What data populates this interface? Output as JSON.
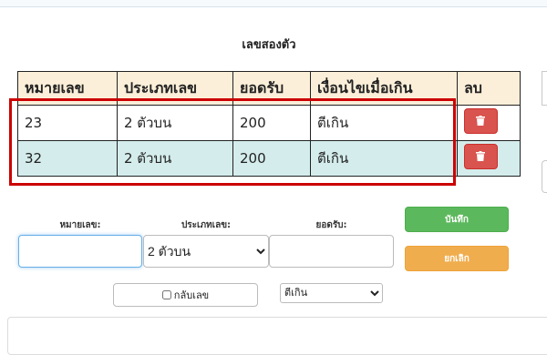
{
  "section_title": "เลขสองตัว",
  "table": {
    "headers": [
      "หมายเลข",
      "ประเภทเลข",
      "ยอดรับ",
      "เงื่อนไขเมื่อเกิน",
      "ลบ"
    ],
    "rows": [
      {
        "number": "23",
        "type": "2 ตัวบน",
        "amount": "200",
        "condition": "ตีเกิน"
      },
      {
        "number": "32",
        "type": "2 ตัวบน",
        "amount": "200",
        "condition": "ตีเกิน"
      }
    ],
    "delete_icon": "trash-icon"
  },
  "form": {
    "number_label": "หมายเลข:",
    "number_value": "",
    "type_label": "ประเภทเลข:",
    "type_selected": "2 ตัวบน",
    "amount_label": "ยอดรับ:",
    "amount_value": "",
    "save_label": "บันทึก",
    "cancel_label": "ยกเลิก",
    "reverse_label": "กลับเลข",
    "reverse_checked": false,
    "condition_selected": "ตีเกิน"
  },
  "colors": {
    "header_bg": "#fcefd9",
    "alt_row_bg": "#d4ecec",
    "delete_btn": "#d9534f",
    "save_btn": "#5cb85c",
    "cancel_btn": "#f0ad4e",
    "highlight": "#cc0000"
  }
}
